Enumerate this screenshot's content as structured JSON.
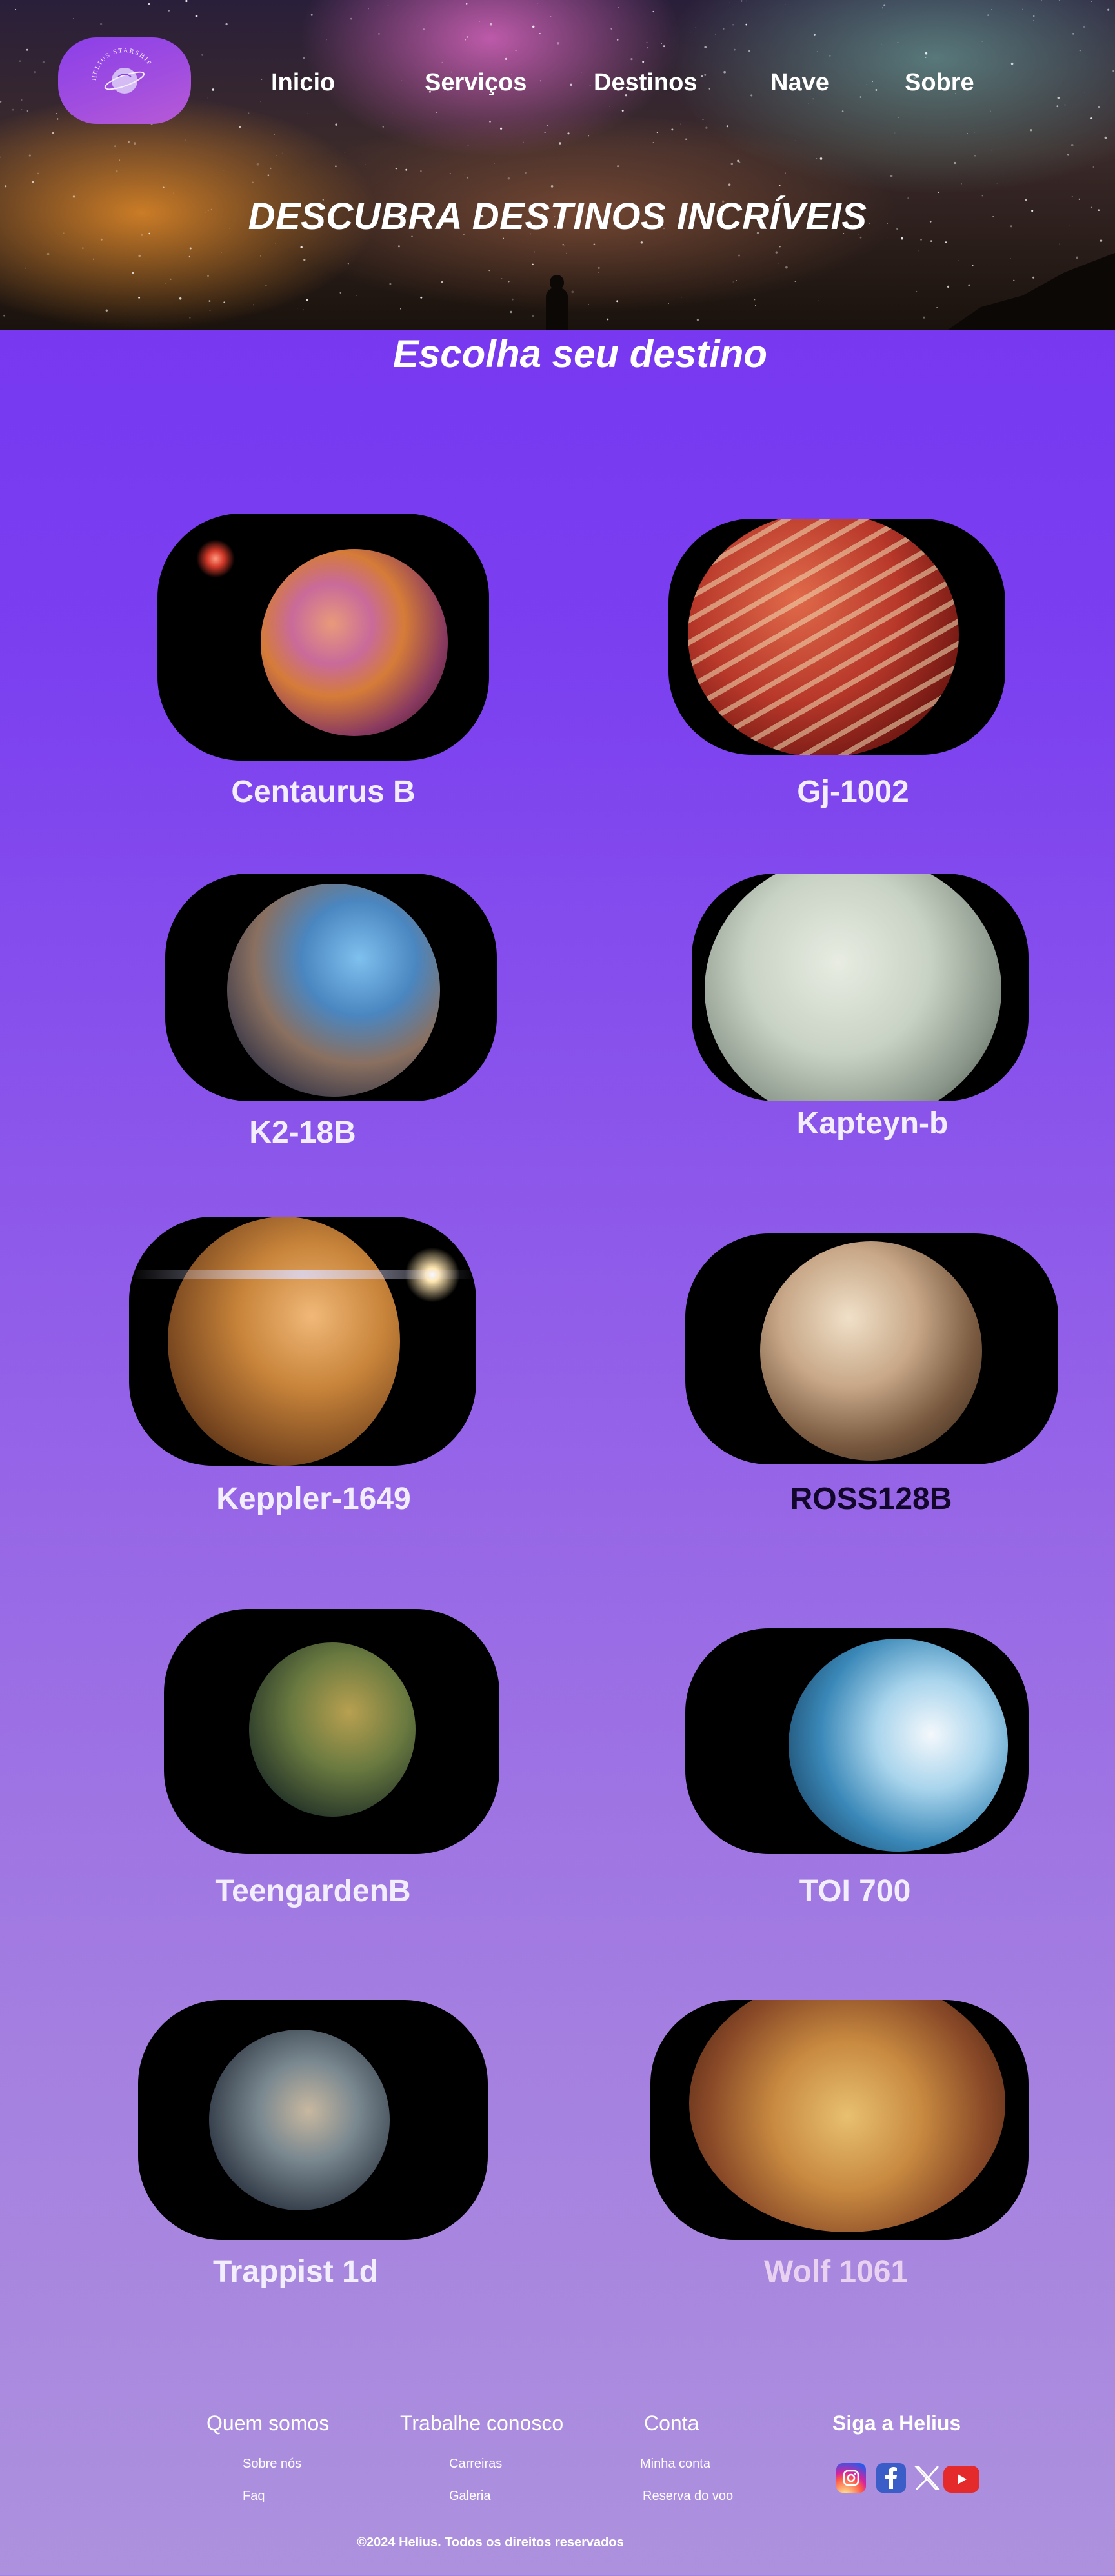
{
  "nav": {
    "logo_text": "HELIUS STARSHIP",
    "items": [
      "Inicio",
      "Serviços",
      "Destinos",
      "Nave",
      "Sobre"
    ]
  },
  "hero": {
    "title": "DESCUBRA DESTINOS INCRÍVEIS"
  },
  "section": {
    "title": "Escolha seu destino"
  },
  "destinations": [
    {
      "name": "Centaurus B",
      "icon": "planet-centaurus-b-image"
    },
    {
      "name": "Gj-1002",
      "icon": "planet-gj-1002-image"
    },
    {
      "name": "K2-18B",
      "icon": "planet-k2-18b-image"
    },
    {
      "name": "Kapteyn-b",
      "icon": "planet-kapteyn-b-image"
    },
    {
      "name": "Keppler-1649",
      "icon": "planet-keppler-1649-image"
    },
    {
      "name": "ROSS128B",
      "icon": "planet-ross128b-image"
    },
    {
      "name": "TeengardenB",
      "icon": "planet-teengardenb-image"
    },
    {
      "name": "TOI 700",
      "icon": "planet-toi-700-image"
    },
    {
      "name": "Trappist 1d",
      "icon": "planet-trappist-1d-image"
    },
    {
      "name": "Wolf 1061",
      "icon": "planet-wolf-1061-image"
    }
  ],
  "footer": {
    "columns": [
      {
        "heading": "Quem somos",
        "links": [
          "Sobre nós",
          "Faq"
        ]
      },
      {
        "heading": "Trabalhe conosco",
        "links": [
          "Carreiras",
          "Galeria"
        ]
      },
      {
        "heading": "Conta",
        "links": [
          "Minha conta",
          "Reserva do voo"
        ]
      }
    ],
    "social_heading": "Siga a Helius",
    "social": [
      "instagram-icon",
      "facebook-icon",
      "x-icon",
      "youtube-icon"
    ],
    "copyright": "©2024 Helius. Todos os  direitos reservados"
  },
  "colors": {
    "accent": "#7331f0",
    "caption_default": "#f2eefe",
    "caption_dark": "#12062a",
    "caption_faded": "#e8d2f0"
  }
}
